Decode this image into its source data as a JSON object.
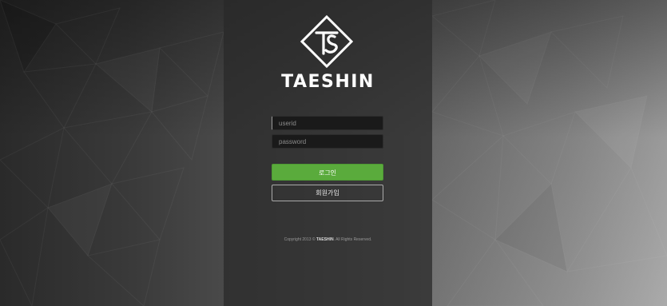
{
  "brand": {
    "name": "TAESHIN",
    "logo_icon": "ts-diamond-logo-icon"
  },
  "form": {
    "userid_placeholder": "userid",
    "password_placeholder": "password",
    "login_label": "로그인",
    "join_label": "회원가입"
  },
  "footer": {
    "copyright_prefix": "Copyright 2013 © ",
    "copyright_brand": "TAESHIN",
    "copyright_suffix": ". All Rights Reserved."
  },
  "colors": {
    "accent_green": "#5aab3c",
    "panel": "#2b2b2b",
    "text": "#ffffff"
  }
}
